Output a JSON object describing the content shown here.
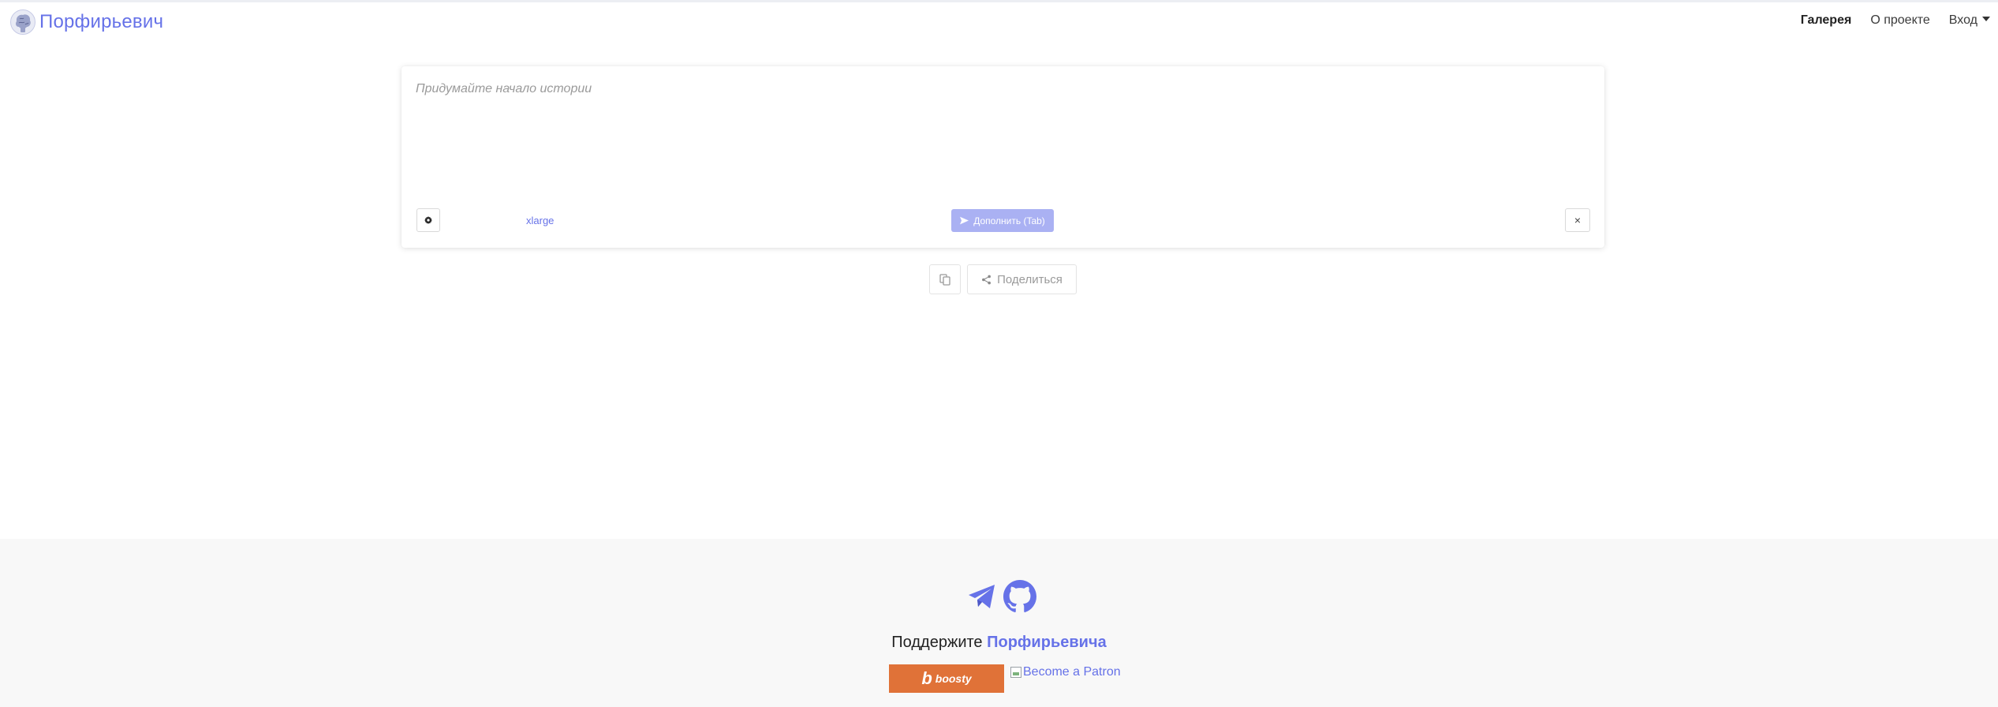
{
  "navbar": {
    "brand": "Порфирьевич",
    "items": [
      {
        "label": "Галерея",
        "active": true
      },
      {
        "label": "О проекте",
        "active": false
      }
    ],
    "login": "Вход"
  },
  "editor": {
    "placeholder": "Придумайте начало истории",
    "model": "xlarge",
    "generate_label": "Дополнить (Tab)",
    "clear_label": "×"
  },
  "actions": {
    "share_label": "Поделиться"
  },
  "footer": {
    "support_prefix": "Поддержите",
    "support_name": "Порфирьевича",
    "boosty_label": "boosty",
    "patron_alt": "Become a Patron"
  },
  "colors": {
    "accent": "#6672e8",
    "accent_disabled": "#aab1f3",
    "boosty": "#e07238",
    "footer_bg": "#f8f8f8"
  }
}
